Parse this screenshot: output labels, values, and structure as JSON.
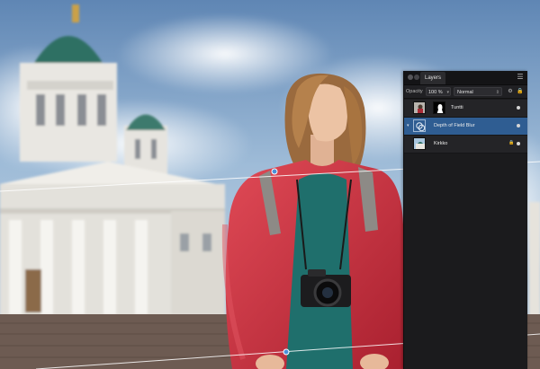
{
  "photo": {
    "subject": "woman-in-red-jacket",
    "background": "white-domed-cathedral",
    "colors": {
      "sky": "#a9c6de",
      "jacket": "#c8313e",
      "shirt": "#1f6f6c",
      "steps": "#6d5b52",
      "building": "#e7e5df"
    }
  },
  "panel": {
    "tab_label": "Layers",
    "opacity_label": "Opacity",
    "opacity_value": "100 %",
    "blend_mode": "Normal",
    "layers": [
      {
        "name": "Tuntti",
        "type": "pixel-with-mask",
        "selected": false,
        "visible": true,
        "locked": false
      },
      {
        "name": "Depth of Field Blur",
        "type": "live-filter",
        "selected": true,
        "visible": true,
        "locked": false
      },
      {
        "name": "Kirkko",
        "type": "pixel",
        "selected": false,
        "visible": true,
        "locked": true
      }
    ],
    "colors": {
      "bg": "#1b1b1d",
      "selected": "#2f5d92",
      "text": "#ececec"
    },
    "icons": [
      "panel-menu-icon",
      "gear-icon",
      "lock-icon",
      "visibility-dot-icon",
      "filter-icon",
      "expand-arrow-icon"
    ]
  }
}
